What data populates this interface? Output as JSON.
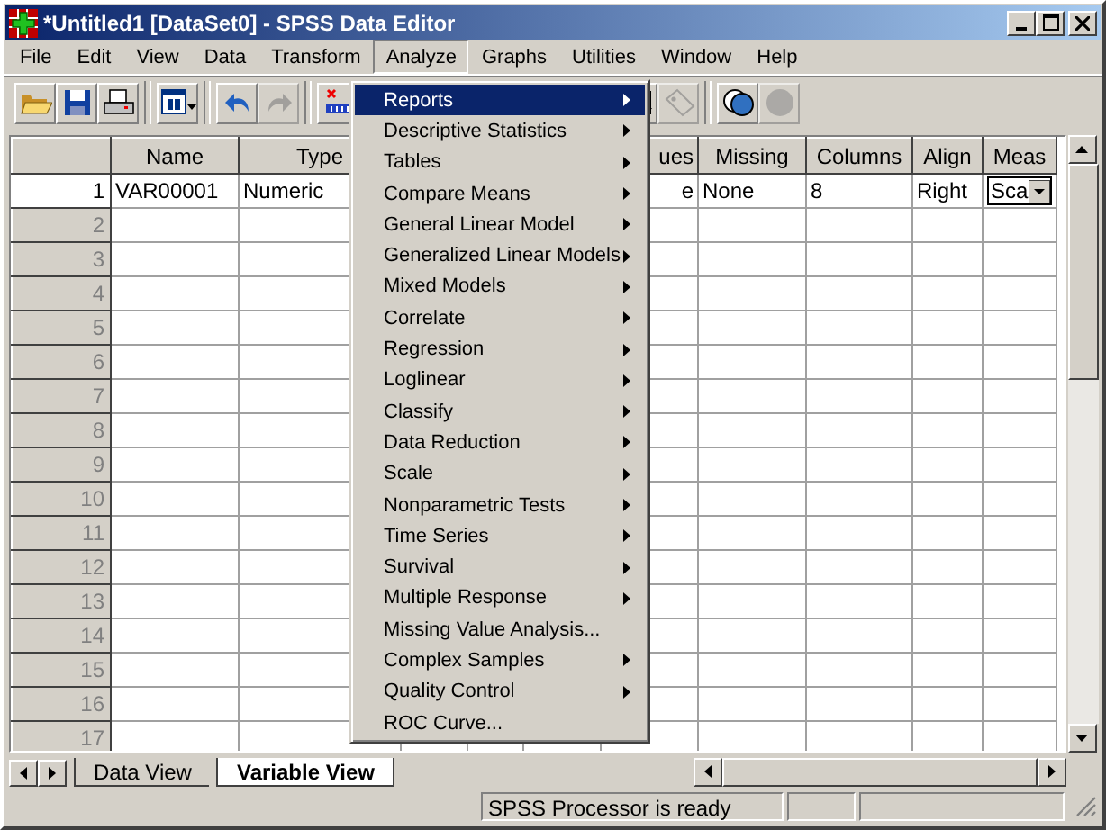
{
  "window": {
    "title": "*Untitled1 [DataSet0] - SPSS Data Editor"
  },
  "menus": [
    {
      "label": "File",
      "selected": false
    },
    {
      "label": "Edit",
      "selected": false
    },
    {
      "label": "View",
      "selected": false
    },
    {
      "label": "Data",
      "selected": false
    },
    {
      "label": "Transform",
      "selected": false
    },
    {
      "label": "Analyze",
      "selected": true
    },
    {
      "label": "Graphs",
      "selected": false
    },
    {
      "label": "Utilities",
      "selected": false
    },
    {
      "label": "Window",
      "selected": false
    },
    {
      "label": "Help",
      "selected": false
    }
  ],
  "toolbar_buttons": [
    {
      "disabled": false
    },
    {
      "disabled": false
    },
    {
      "disabled": false
    },
    {
      "disabled": false
    },
    {
      "disabled": false
    },
    {
      "disabled": true
    },
    {
      "disabled": false
    },
    {
      "disabled": false
    },
    {
      "disabled": true
    },
    {
      "disabled": false
    },
    {
      "disabled": true
    }
  ],
  "table": {
    "columns": [
      "Name",
      "Type",
      null,
      null,
      null,
      "ues",
      "Missing",
      "Columns",
      "Align",
      "Meas"
    ],
    "rows": [
      {
        "label": "1",
        "selected": true,
        "cells": [
          "VAR00001",
          "Numeric",
          null,
          null,
          null,
          "e",
          "None",
          "8",
          "Right",
          "Sca"
        ]
      },
      {
        "label": "2",
        "selected": false
      },
      {
        "label": "3",
        "selected": false
      },
      {
        "label": "4",
        "selected": false
      },
      {
        "label": "5",
        "selected": false
      },
      {
        "label": "6",
        "selected": false
      },
      {
        "label": "7",
        "selected": false
      },
      {
        "label": "8",
        "selected": false
      },
      {
        "label": "9",
        "selected": false
      },
      {
        "label": "10",
        "selected": false
      },
      {
        "label": "11",
        "selected": false
      },
      {
        "label": "12",
        "selected": false
      },
      {
        "label": "13",
        "selected": false
      },
      {
        "label": "14",
        "selected": false
      },
      {
        "label": "15",
        "selected": false
      },
      {
        "label": "16",
        "selected": false
      },
      {
        "label": "17",
        "selected": false
      }
    ]
  },
  "analyze_menu": [
    {
      "label": "Reports",
      "submenu": true,
      "selected": true
    },
    {
      "label": "Descriptive Statistics",
      "submenu": true,
      "selected": false
    },
    {
      "label": "Tables",
      "submenu": true,
      "selected": false
    },
    {
      "label": "Compare Means",
      "submenu": true,
      "selected": false
    },
    {
      "label": "General Linear Model",
      "submenu": true,
      "selected": false
    },
    {
      "label": "Generalized Linear Models",
      "submenu": true,
      "selected": false
    },
    {
      "label": "Mixed Models",
      "submenu": true,
      "selected": false
    },
    {
      "label": "Correlate",
      "submenu": true,
      "selected": false
    },
    {
      "label": "Regression",
      "submenu": true,
      "selected": false
    },
    {
      "label": "Loglinear",
      "submenu": true,
      "selected": false
    },
    {
      "label": "Classify",
      "submenu": true,
      "selected": false
    },
    {
      "label": "Data Reduction",
      "submenu": true,
      "selected": false
    },
    {
      "label": "Scale",
      "submenu": true,
      "selected": false
    },
    {
      "label": "Nonparametric Tests",
      "submenu": true,
      "selected": false
    },
    {
      "label": "Time Series",
      "submenu": true,
      "selected": false
    },
    {
      "label": "Survival",
      "submenu": true,
      "selected": false
    },
    {
      "label": "Multiple Response",
      "submenu": true,
      "selected": false
    },
    {
      "label": "Missing Value Analysis...",
      "submenu": false,
      "selected": false
    },
    {
      "label": "Complex Samples",
      "submenu": true,
      "selected": false
    },
    {
      "label": "Quality Control",
      "submenu": true,
      "selected": false
    },
    {
      "label": "ROC Curve...",
      "submenu": false,
      "selected": false
    }
  ],
  "tabs": [
    {
      "label": "Data View",
      "selected": false
    },
    {
      "label": "Variable View",
      "selected": true
    }
  ],
  "status_bar": {
    "message": "SPSS Processor is ready"
  }
}
